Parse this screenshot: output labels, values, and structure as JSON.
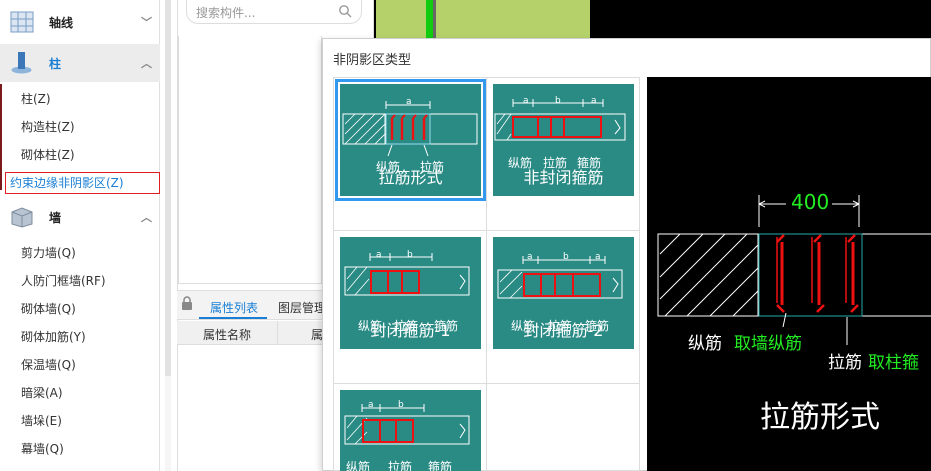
{
  "nav": {
    "cat_axis": "轴线",
    "cat_column": "柱",
    "column_items": [
      "柱(Z)",
      "构造柱(Z)",
      "砌体柱(Z)",
      "约束边缘非阴影区(Z)"
    ],
    "cat_wall": "墙",
    "wall_items": [
      "剪力墙(Q)",
      "人防门框墙(RF)",
      "砌体墙(Q)",
      "砌体加筋(Y)",
      "保温墙(Q)",
      "暗梁(A)",
      "墙垛(E)",
      "幕墙(Q)"
    ]
  },
  "panel": {
    "search_placeholder": "搜索构件...",
    "tab_props": "属性列表",
    "tab_layers": "图层管理",
    "col_name": "属性名称",
    "col_value": "属"
  },
  "dialog": {
    "title": "非阴影区类型",
    "cards": [
      {
        "title": "拉筋形式",
        "dims": [
          "a"
        ],
        "labels": [
          "纵筋",
          "拉筋"
        ]
      },
      {
        "title": "非封闭箍筋",
        "dims": [
          "a",
          "b",
          "a"
        ],
        "labels": [
          "纵筋",
          "拉筋",
          "箍筋"
        ]
      },
      {
        "title": "封闭箍筋-1",
        "dims": [
          "a",
          "b"
        ],
        "labels": [
          "纵筋",
          "拉筋",
          "箍筋"
        ]
      },
      {
        "title": "封闭箍筋-2",
        "dims": [
          "a",
          "b",
          "a"
        ],
        "labels": [
          "纵筋",
          "拉筋",
          "箍筋"
        ]
      },
      {
        "title": "",
        "dims": [
          "a",
          "b"
        ],
        "labels": [
          "纵筋",
          "拉筋",
          "箍筋"
        ]
      }
    ],
    "selected_index": 0
  },
  "preview": {
    "dimension": "400",
    "callout1_white": "纵筋",
    "callout1_green": "取墙纵筋",
    "callout2_white": "拉筋",
    "callout2_green": "取柱箍",
    "title": "拉筋形式"
  },
  "colors": {
    "accent": "#1a7fd4",
    "card": "#2a8b85",
    "rebar": "#ee1111",
    "cad_green": "#22ee22",
    "selection_border": "#e02020"
  }
}
